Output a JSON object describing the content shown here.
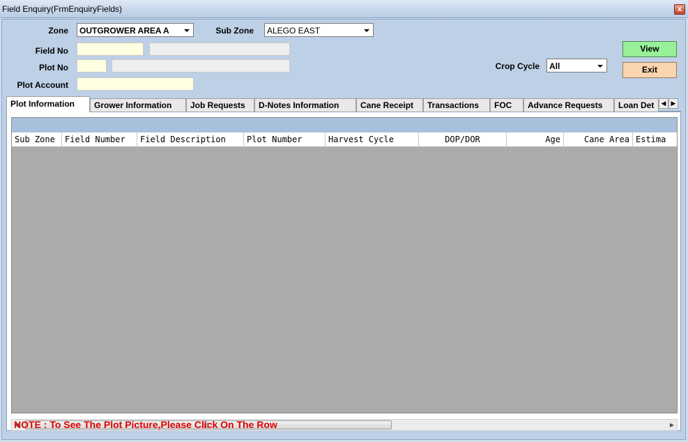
{
  "window": {
    "title": "Field Enquiry(FrmEnquiryFields)",
    "close_label": "x"
  },
  "form": {
    "zone_label": "Zone",
    "zone_value": "OUTGROWER AREA A",
    "subzone_label": "Sub Zone",
    "subzone_value": "ALEGO EAST",
    "field_no_label": "Field No",
    "field_no_value": "",
    "field_desc_value": "",
    "plot_no_label": "Plot No",
    "plot_no_value": "",
    "plot_desc_value": "",
    "plot_account_label": "Plot Account",
    "plot_account_value": "",
    "crop_cycle_label": "Crop Cycle",
    "crop_cycle_value": "All",
    "view_label": "View",
    "exit_label": "Exit"
  },
  "tabs": [
    {
      "label": "Plot Information",
      "active": true
    },
    {
      "label": "Grower Information",
      "active": false
    },
    {
      "label": "Job Requests",
      "active": false
    },
    {
      "label": "D-Notes Information",
      "active": false
    },
    {
      "label": "Cane Receipt",
      "active": false
    },
    {
      "label": "Transactions",
      "active": false
    },
    {
      "label": "FOC",
      "active": false
    },
    {
      "label": "Advance Requests",
      "active": false
    },
    {
      "label": "Loan Det",
      "active": false
    }
  ],
  "grid": {
    "columns": [
      "Sub Zone",
      "Field Number",
      "Field Description",
      "Plot Number",
      "Harvest Cycle",
      "DOP/DOR",
      "Age",
      "Cane Area",
      "Estima"
    ],
    "rows": []
  },
  "note": "NOTE : To See The Plot Picture,Please Click On The Row",
  "colors": {
    "view_button": "#98f098",
    "exit_button": "#fbd4b0",
    "note_text": "#e00000",
    "grid_background": "#ababab"
  }
}
